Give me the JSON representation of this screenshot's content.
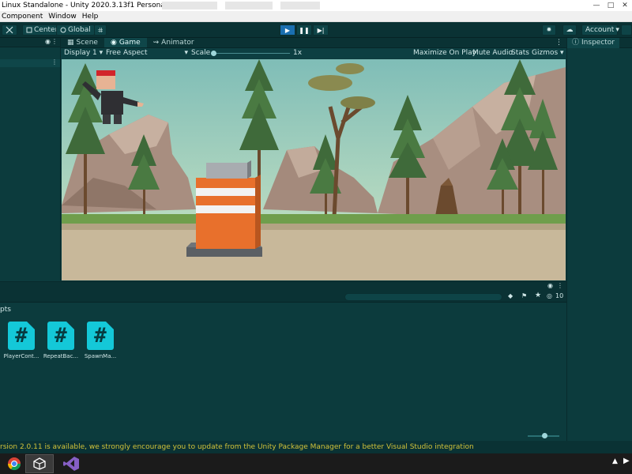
{
  "window": {
    "title": "Linux Standalone - Unity 2020.3.13f1 Personal <DX11>"
  },
  "menu": {
    "items": [
      "Component",
      "Window",
      "Help"
    ]
  },
  "toolbar": {
    "center_label": "Center",
    "global_label": "Global",
    "account_label": "Account"
  },
  "tabs": {
    "scene": "Scene",
    "game": "Game",
    "animator": "Animator"
  },
  "gamebar": {
    "display": "Display 1",
    "aspect": "Free Aspect",
    "scale_label": "Scale",
    "scale_value": "1x",
    "maximize": "Maximize On Play",
    "mute": "Mute Audio",
    "stats": "Stats",
    "gizmos": "Gizmos"
  },
  "inspector": {
    "tab_label": "Inspector"
  },
  "project": {
    "breadcrumb": "pts",
    "visible_count": "10",
    "assets": [
      {
        "label": "PlayerCont..."
      },
      {
        "label": "RepeatBac..."
      },
      {
        "label": "SpawnMa..."
      }
    ]
  },
  "status": {
    "message": "rsion 2.0.11 is available, we strongly encourage you to update from the Unity Package Manager for a better Visual Studio integration"
  },
  "colors": {
    "editor_bg": "#0c3b3d",
    "accent_play": "#1a6fb0",
    "script_icon": "#14c8d8",
    "status_text": "#d1c23a",
    "obstacle_orange": "#e8702c"
  },
  "icons": {
    "taskbar": [
      "chrome-icon",
      "unity-icon",
      "visual-studio-icon"
    ]
  }
}
